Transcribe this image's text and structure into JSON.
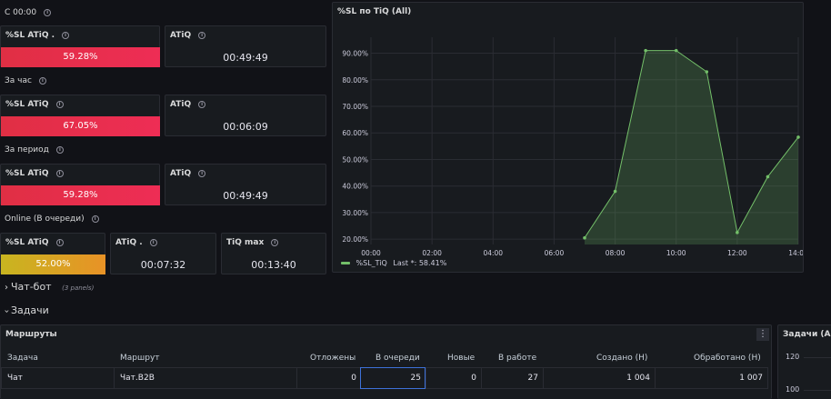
{
  "sections": {
    "s1": "С 00:00",
    "s2": "За час",
    "s3": "За период",
    "s4": "Online (В очереди)"
  },
  "panels": {
    "sl_today": {
      "title": "%SL ATiQ .",
      "value": "59.28%"
    },
    "atiq_today": {
      "title": "ATiQ",
      "value": "00:49:49"
    },
    "sl_hour": {
      "title": "%SL ATiQ",
      "value": "67.05%"
    },
    "atiq_hour": {
      "title": "ATiQ",
      "value": "00:06:09"
    },
    "sl_period": {
      "title": "%SL ATiQ",
      "value": "59.28%"
    },
    "atiq_period": {
      "title": "ATiQ",
      "value": "00:49:49"
    },
    "sl_online": {
      "title": "%SL ATiQ",
      "value": "52.00%"
    },
    "atiq_online": {
      "title": "ATiQ .",
      "value": "00:07:32"
    },
    "tiq_max": {
      "title": "TiQ max",
      "value": "00:13:40"
    }
  },
  "rows": {
    "chatbot": {
      "label": "Чат-бот",
      "note": "(3 panels)",
      "chevron": "›"
    },
    "tasks": {
      "label": "Задачи",
      "chevron": "›"
    }
  },
  "info_glyph": "i",
  "chart_data": {
    "type": "area",
    "title": "%SL по TiQ (All)",
    "x": [
      "07:00",
      "08:00",
      "09:00",
      "10:00",
      "11:00",
      "12:00",
      "13:00",
      "14:00"
    ],
    "xticks": [
      "00:00",
      "02:00",
      "04:00",
      "06:00",
      "08:00",
      "10:00",
      "12:00",
      "14:00"
    ],
    "xrange_hours": [
      0,
      14
    ],
    "yticks": [
      "20.00%",
      "30.00%",
      "40.00%",
      "50.00%",
      "60.00%",
      "70.00%",
      "80.00%",
      "90.00%"
    ],
    "ylim": [
      18,
      96
    ],
    "grid": true,
    "series": [
      {
        "name": "%SL_TiQ",
        "values": [
          20.5,
          38,
          91,
          91,
          83,
          22.5,
          43.5,
          58.4
        ],
        "color": "#73bf69"
      }
    ],
    "legend": {
      "series_label": "%SL_TiQ",
      "last_label": "Last *: 58.41%"
    },
    "legend_position": "bottom-left"
  },
  "routes_table": {
    "title": "Маршруты",
    "menu_glyph": "⋮",
    "columns": [
      "Задача",
      "Маршрут",
      "Отложены",
      "В очереди",
      "Новые",
      "В работе",
      "Создано (Н)",
      "Обработано (Н)"
    ],
    "rows": [
      [
        "Чат",
        "Чат.B2B",
        "0",
        "25",
        "0",
        "27",
        "1 004",
        "1 007"
      ]
    ]
  },
  "tasks_chart": {
    "title": "Задачи (All)",
    "yticks": [
      "120",
      "100"
    ]
  },
  "colors": {
    "background": "#111217",
    "panel": "#181b1f",
    "red": "#e02f44",
    "amber": "#e89226",
    "green": "#73bf69"
  }
}
